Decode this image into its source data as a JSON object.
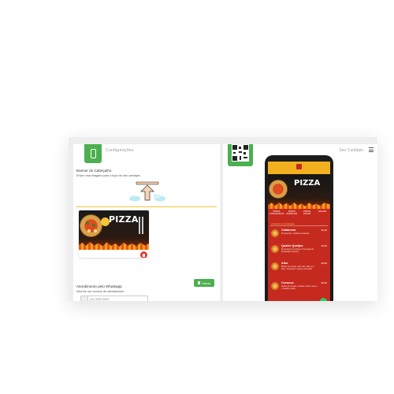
{
  "left_panel": {
    "title": "Configurações",
    "banner_section": {
      "title": "Banner do Cabeçalho",
      "description": "Envie uma imagem para o topo do seu cardápio"
    },
    "banner_preview": {
      "word": "PIZZA"
    },
    "save_label": "Salvar",
    "whatsapp_section": {
      "title": "Atendimento pelo Whatsapp",
      "description": "Informe um numero de atendimento",
      "placeholder": "(11) 2222-2222"
    }
  },
  "right_panel": {
    "title": "Seu Cardápio"
  },
  "phone_menu": {
    "banner_word": "PIZZA",
    "categories": [
      "PIZZAS TRADICIONAIS",
      "PIZZAS ESPECIAIS",
      "PIZZAS DOCES",
      "SALGAD"
    ],
    "promo": "produtos em destaque",
    "items": [
      {
        "name": "Calabresa",
        "desc": "Mussarela e Calabresa fatiada",
        "price": "39,90"
      },
      {
        "name": "Quatro Queijos",
        "desc": "Mussarela, Provolone, Parmesão E Requeijão Catupiry",
        "price": "49,90"
      },
      {
        "name": "Alho",
        "desc": "Molho de tomate, alho frito, alho em óleo, muçarela e queijo parmesão",
        "price": "39,90"
      },
      {
        "name": "Cecucoz",
        "desc": "Molho de tomate, Cebola e Alho, bacon e batalha palha",
        "price": "39,90"
      }
    ]
  },
  "colors": {
    "accent_green": "#4caf50",
    "menu_red": "#c62a1e",
    "menu_yellow": "#f2b01e",
    "divider_yellow": "#f3c33a",
    "delete_red": "#e53935"
  }
}
